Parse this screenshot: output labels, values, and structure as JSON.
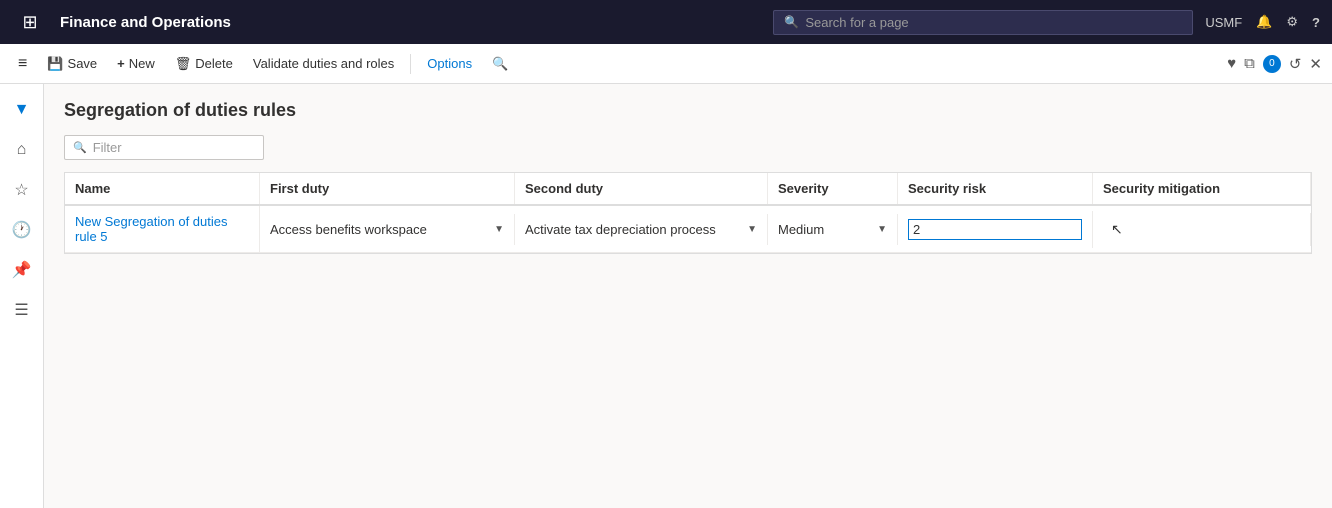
{
  "app": {
    "title": "Finance and Operations",
    "search_placeholder": "Search for a page"
  },
  "top_nav": {
    "user": "USMF",
    "bell_icon": "bell-icon",
    "gear_icon": "gear-icon",
    "question_icon": "question-icon"
  },
  "toolbar": {
    "save_label": "Save",
    "new_label": "New",
    "delete_label": "Delete",
    "validate_label": "Validate duties and roles",
    "options_label": "Options",
    "search_icon": "search-icon"
  },
  "sidebar": {
    "icons": [
      "menu-icon",
      "home-icon",
      "star-icon",
      "clock-icon",
      "pin-icon",
      "list-icon"
    ]
  },
  "page": {
    "title": "Segregation of duties rules",
    "filter_placeholder": "Filter"
  },
  "table": {
    "columns": [
      "Name",
      "First duty",
      "Second duty",
      "Severity",
      "Security risk",
      "Security mitigation"
    ],
    "rows": [
      {
        "name": "New Segregation of duties rule 5",
        "first_duty": "Access benefits workspace",
        "second_duty": "Activate tax depreciation process",
        "severity": "Medium",
        "security_risk": "2",
        "security_mitigation": ""
      }
    ]
  }
}
